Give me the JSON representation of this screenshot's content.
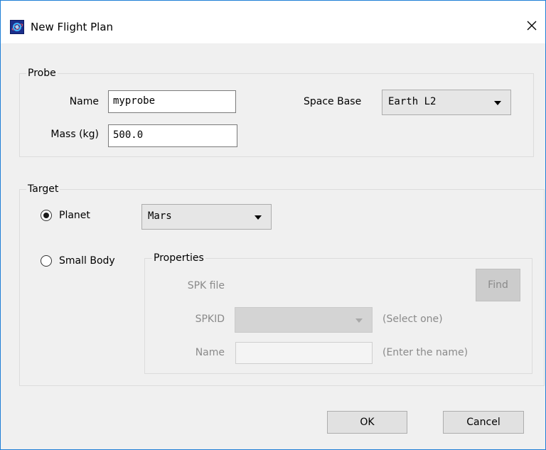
{
  "window": {
    "title": "New Flight Plan",
    "close_symbol": "close-icon",
    "app_icon": "orbit-app-icon"
  },
  "probe": {
    "group_label": "Probe",
    "name_label": "Name",
    "name_value": "myprobe",
    "mass_label": "Mass (kg)",
    "mass_value": "500.0",
    "space_base_label": "Space Base",
    "space_base_value": "Earth L2"
  },
  "target": {
    "group_label": "Target",
    "planet_label": "Planet",
    "planet_selected": true,
    "planet_value": "Mars",
    "small_body_label": "Small Body",
    "small_body_selected": false,
    "properties": {
      "group_label": "Properties",
      "spk_file_label": "SPK file",
      "find_label": "Find",
      "spkid_label": "SPKID",
      "spkid_value": "",
      "spkid_hint": "(Select one)",
      "name_label": "Name",
      "name_value": "",
      "name_hint": "(Enter the name)"
    }
  },
  "footer": {
    "ok_label": "OK",
    "cancel_label": "Cancel"
  }
}
